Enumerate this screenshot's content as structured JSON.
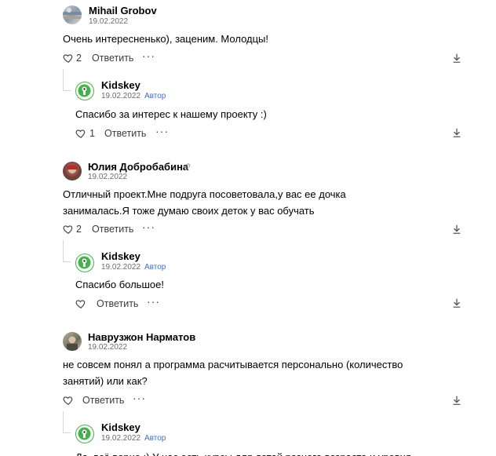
{
  "comments": [
    {
      "author": "Mihail Grobov",
      "date": "19.02.2022",
      "text": "Очень интересненько), заценим. Молодцы!",
      "likes": "2",
      "reply_label": "Ответить",
      "more_label": "···",
      "reply": {
        "author": "Kidskey",
        "date": "19.02.2022",
        "badge": "Автор",
        "text": "Спасибо за интерес к нашему проекту :)",
        "likes": "1",
        "reply_label": "Ответить",
        "more_label": "···"
      }
    },
    {
      "author": "Юлия Добробабина",
      "date": "19.02.2022",
      "text": "Отличный проект.Мне подруга посоветовала,у вас ее дочка занималась.Я тоже думаю своих деток у вас обучать",
      "likes": "2",
      "reply_label": "Ответить",
      "more_label": "···",
      "reply": {
        "author": "Kidskey",
        "date": "19.02.2022",
        "badge": "Автор",
        "text": "Спасибо большое!",
        "likes": "",
        "reply_label": "Ответить",
        "more_label": "···"
      }
    },
    {
      "author": "Навруз­жон Нарматов",
      "date": "19.02.2022",
      "text": "не совсем понял а программа расчитывается персонально (количество занятий) или как?",
      "likes": "",
      "reply_label": "Ответить",
      "more_label": "···",
      "reply": {
        "author": "Kidskey",
        "date": "19.02.2022",
        "badge": "Автор",
        "text": "Да, всё верно :) У нас есть курсы для детей разного возраста и уровня"
      }
    }
  ],
  "icons": {
    "like": "heart-icon",
    "sort": "sort-down-icon",
    "link": "link-icon"
  },
  "colors": {
    "accent": "#3d6fc4",
    "kidskey_green": "#43b24a"
  }
}
